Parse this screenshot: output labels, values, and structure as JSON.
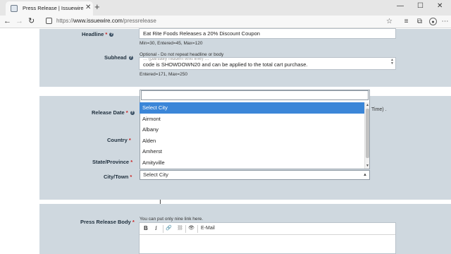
{
  "browser": {
    "tab_title": "Press Release | Issuewire",
    "tab_close": "✕",
    "new_tab": "+",
    "url_scheme": "https://",
    "url_host": "www.issuewire.com",
    "url_path": "/pressrelease",
    "window_controls": [
      "—",
      "☐",
      "✕"
    ],
    "nav": {
      "back": "←",
      "forward": "→",
      "reload": "↻"
    },
    "toolbar_icons": [
      "star-icon",
      "favorites-icon",
      "collections-icon",
      "profile-icon",
      "more-icon"
    ]
  },
  "form": {
    "headline": {
      "label": "Headline",
      "required": "*",
      "help": "?",
      "value": "Eat Rite Foods Releases a 20% Discount Coupon",
      "hint": "Min=30, Entered=45, Max=120"
    },
    "subhead": {
      "label": "Subhead",
      "help": "?",
      "hint_top": "Optional - Do not repeat headline or body",
      "value_line1": "... (partially hidden text line) ...",
      "value_line2": "code is SHOWDOWN20 and can be applied to the total cart purchase.",
      "hint": "Entered=171, Max=250"
    },
    "release_date": {
      "label": "Release Date",
      "required": "*",
      "help": "?",
      "suffix": "Time) ."
    },
    "country": {
      "label": "Country",
      "required": "*"
    },
    "state": {
      "label": "State/Province",
      "required": "*"
    },
    "city": {
      "label": "City/Town",
      "required": "*",
      "search_value": "",
      "options": [
        "Select City",
        "Airmont",
        "Albany",
        "Alden",
        "Amherst",
        "Amityville"
      ],
      "selected_index": 0,
      "select_value": "Select City",
      "arrow": "▲"
    },
    "body": {
      "label": "Press Release Body",
      "required": "*",
      "hint": "You can put only nine link here.",
      "toolbar": {
        "bold": "B",
        "italic": "I",
        "link": "🔗",
        "unlink": "⛓",
        "source": "👁",
        "email": "E-Mail"
      }
    }
  }
}
